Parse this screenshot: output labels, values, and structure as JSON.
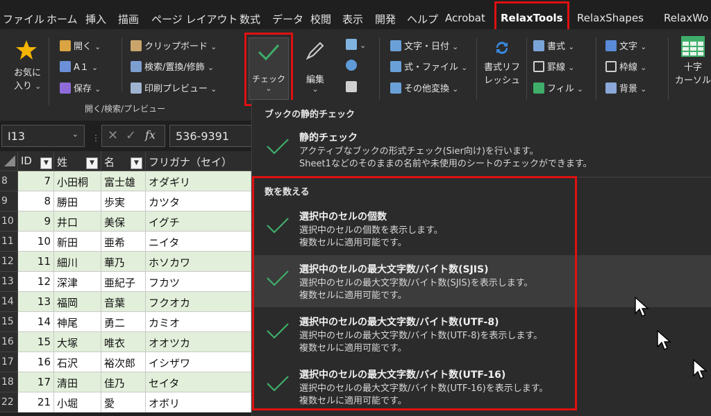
{
  "tabs": [
    "ファイル",
    "ホーム",
    "挿入",
    "描画",
    "ページ レイアウト",
    "数式",
    "データ",
    "校閲",
    "表示",
    "開発",
    "ヘルプ",
    "Acrobat",
    "RelaxTools",
    "RelaxShapes",
    "RelaxWo"
  ],
  "active_tab": "RelaxTools",
  "ribbon": {
    "favorites": [
      "お気に",
      "入り"
    ],
    "open": "開く",
    "a1": "A１",
    "save": "保存",
    "clipboard": "クリップボード",
    "search_replace": "検索/置換/修飾",
    "print_preview": "印刷プレビュー",
    "group_label": "開く/検索/プレビュー",
    "check": "チェック",
    "edit": "編集",
    "text_date": "文字・日付",
    "formula_file": "式・ファイル",
    "other_convert": "その他変換",
    "format_refresh": [
      "書式リフ",
      "レッシュ"
    ],
    "format": "書式",
    "border": "罫線",
    "fill": "フィル",
    "char": "文字",
    "frame": "枠線",
    "background": "背景",
    "crosshair": [
      "十字",
      "カーソル"
    ]
  },
  "formula_bar": {
    "name_box": "I13",
    "value": "536-9391",
    "fx": "fx"
  },
  "sheet": {
    "headers": [
      "ID",
      "姓",
      "名",
      "フリガナ（セイ）"
    ],
    "rows": [
      {
        "r": "8",
        "id": "7",
        "sei": "小田桐",
        "mei": "富士雄",
        "kana": "オダギリ"
      },
      {
        "r": "9",
        "id": "8",
        "sei": "勝田",
        "mei": "歩実",
        "kana": "カツタ"
      },
      {
        "r": "10",
        "id": "9",
        "sei": "井口",
        "mei": "美保",
        "kana": "イグチ"
      },
      {
        "r": "11",
        "id": "10",
        "sei": "新田",
        "mei": "亜希",
        "kana": "ニイタ"
      },
      {
        "r": "12",
        "id": "11",
        "sei": "細川",
        "mei": "華乃",
        "kana": "ホソカワ"
      },
      {
        "r": "13",
        "id": "12",
        "sei": "深津",
        "mei": "亜紀子",
        "kana": "フカツ"
      },
      {
        "r": "14",
        "id": "13",
        "sei": "福岡",
        "mei": "音葉",
        "kana": "フクオカ"
      },
      {
        "r": "15",
        "id": "14",
        "sei": "神尾",
        "mei": "勇二",
        "kana": "カミオ"
      },
      {
        "r": "16",
        "id": "15",
        "sei": "大塚",
        "mei": "唯衣",
        "kana": "オオツカ"
      },
      {
        "r": "17",
        "id": "16",
        "sei": "石沢",
        "mei": "裕次郎",
        "kana": "イシザワ"
      },
      {
        "r": "18",
        "id": "17",
        "sei": "清田",
        "mei": "佳乃",
        "kana": "セイタ"
      },
      {
        "r": "22",
        "id": "21",
        "sei": "小堀",
        "mei": "愛",
        "kana": "オボリ"
      }
    ]
  },
  "dropdown": {
    "section1": "ブックの静的チェック",
    "static_check": {
      "title": "静的チェック",
      "desc1": "アクティブなブックの形式チェック(Sier向け)を行います。",
      "desc2": "Sheet1などのそのままの名前や未使用のシートのチェックができます。"
    },
    "section2": "数を数える",
    "items": [
      {
        "title": "選択中のセルの個数",
        "desc1": "選択中のセルの個数を表示します。",
        "desc2": "複数セルに適用可能です。"
      },
      {
        "title": "選択中のセルの最大文字数/バイト数(SJIS)",
        "desc1": "選択中のセルの最大文字数/バイト数(SJIS)を表示します。",
        "desc2": "複数セルに適用可能です。"
      },
      {
        "title": "選択中のセルの最大文字数/バイト数(UTF-8)",
        "desc1": "選択中のセルの最大文字数/バイト数(UTF-8)を表示します。",
        "desc2": "複数セルに適用可能です。"
      },
      {
        "title": "選択中のセルの最大文字数/バイト数(UTF-16)",
        "desc1": "選択中のセルの最大文字数/バイト数(UTF-16)を表示します。",
        "desc2": "複数セルに適用可能です。"
      }
    ]
  },
  "colors": {
    "accent_green": "#3fae6a",
    "highlight_red": "#e01010",
    "row_green": "#e2efda"
  }
}
